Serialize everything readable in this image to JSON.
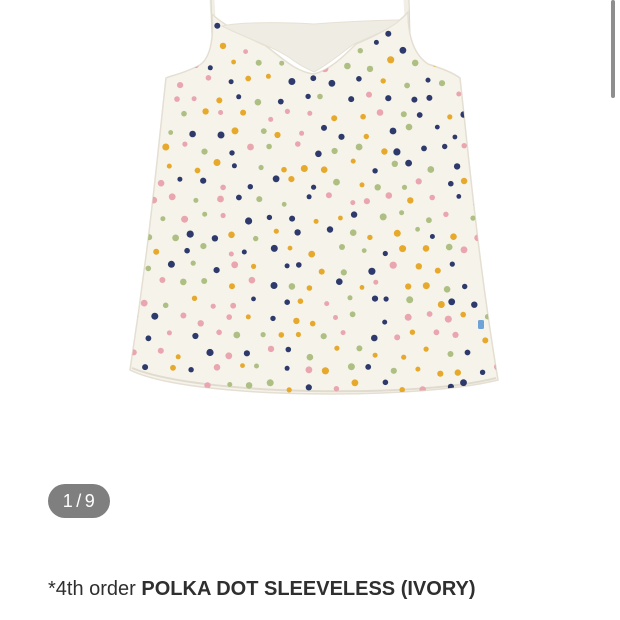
{
  "gallery": {
    "image_alt": "POLKA DOT SLEEVELESS (IVORY)",
    "counter": {
      "current": "1",
      "separator": "/",
      "total": "9"
    }
  },
  "product": {
    "title_prefix": "*4th order",
    "title_name": "POLKA DOT SLEEVELESS (IVORY)"
  },
  "colors": {
    "fabric": "#f6f3ea",
    "dot_navy": "#2d3a6b",
    "dot_pink": "#e9a5b0",
    "dot_mustard": "#e6a92c",
    "dot_sage": "#aebf83",
    "counter_bg": "#7f7f7f"
  }
}
